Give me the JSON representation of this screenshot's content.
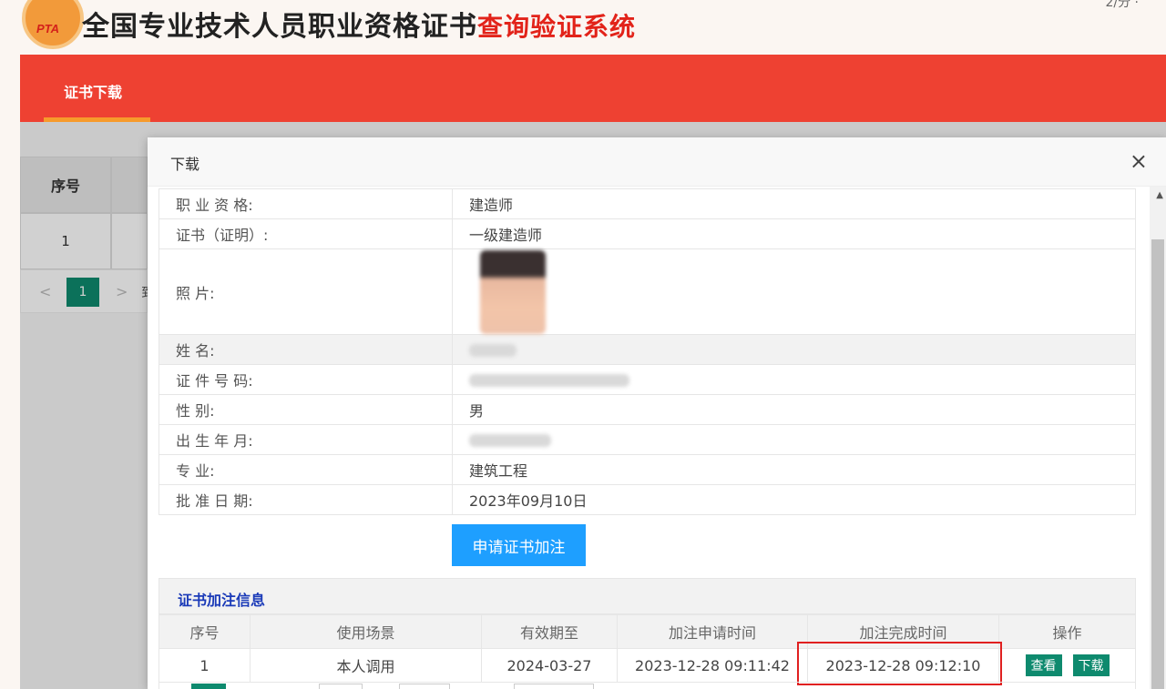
{
  "header": {
    "logo_text": "PTA",
    "title_main": "全国专业技术人员职业资格证书",
    "title_sub": "查询验证系统",
    "top_right": "2/分 ·"
  },
  "nav": {
    "tab_label": "证书下载"
  },
  "background_table": {
    "header_seq": "序号",
    "row_seq": "1",
    "pager_current": "1",
    "pager_prev": "<",
    "pager_next": ">",
    "pager_go": "到"
  },
  "modal": {
    "title": "下载",
    "close_symbol": "×",
    "info_rows": [
      {
        "label": "职 业 资 格:",
        "value": "建造师"
      },
      {
        "label": "证书（证明）:",
        "value": "一级建造师"
      },
      {
        "label": "照          片:",
        "value": ""
      },
      {
        "label": "姓          名:",
        "value": ""
      },
      {
        "label": "证 件 号 码:",
        "value": ""
      },
      {
        "label": "性          别:",
        "value": "男"
      },
      {
        "label": "出 生 年 月:",
        "value": ""
      },
      {
        "label": "专          业:",
        "value": "建筑工程"
      },
      {
        "label": "批 准 日 期:",
        "value": "2023年09月10日"
      }
    ],
    "apply_button": "申请证书加注",
    "section_title": "证书加注信息",
    "annotation_table": {
      "headers": [
        "序号",
        "使用场景",
        "有效期至",
        "加注申请时间",
        "加注完成时间",
        "操作"
      ],
      "rows": [
        {
          "seq": "1",
          "scene": "本人调用",
          "valid_until": "2024-03-27",
          "apply_time": "2023-12-28 09:11:42",
          "complete_time": "2023-12-28 09:12:10",
          "view_label": "查看",
          "download_label": "下载"
        }
      ]
    }
  },
  "colors": {
    "nav_red": "#ee4132",
    "nav_underline": "#f79a2b",
    "primary_blue": "#1e9fff",
    "action_green": "#0e8a6e",
    "section_blue": "#1a3ab8",
    "highlight_red": "#e02020"
  }
}
